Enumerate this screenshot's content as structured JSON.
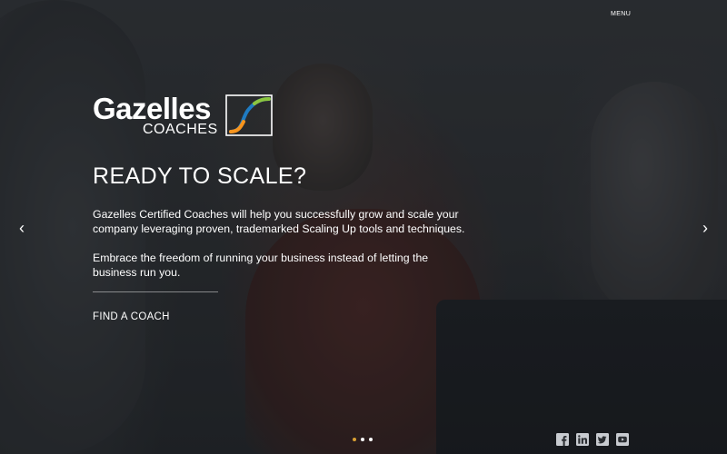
{
  "nav": {
    "menu_label": "MENU"
  },
  "logo": {
    "word": "Gazelles",
    "sub": "COACHES"
  },
  "hero": {
    "headline": "READY TO SCALE?",
    "paragraph_1": "Gazelles Certified Coaches will help you successfully grow and scale your company leveraging proven, trademarked Scaling Up tools and techniques.",
    "paragraph_2": "Embrace the freedom of running your business instead of letting the business run you.",
    "cta_label": "FIND A COACH"
  },
  "carousel": {
    "prev_glyph": "‹",
    "next_glyph": "›",
    "slide_count": 3,
    "active_slide": 1
  },
  "social": {
    "icons": [
      "facebook-icon",
      "linkedin-icon",
      "twitter-icon",
      "youtube-icon"
    ]
  },
  "colors": {
    "active_dot": "#d9a033",
    "logo_blue": "#1f7bc1",
    "logo_green": "#8cc63f",
    "logo_orange": "#f7941d"
  }
}
